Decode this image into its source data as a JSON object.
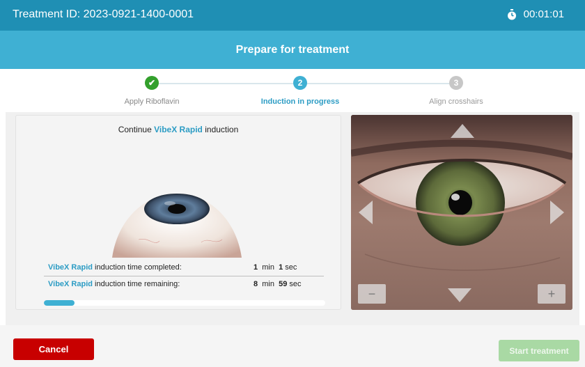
{
  "topbar": {
    "treatment_id": "Treatment ID: 2023-0921-1400-0001",
    "timer": "00:01:01",
    "timer_icon": "stopwatch-icon"
  },
  "header": {
    "title": "Prepare for treatment"
  },
  "steps": [
    {
      "number": "✔",
      "label": "Apply Riboflavin",
      "state": "done"
    },
    {
      "number": "2",
      "label": "Induction in progress",
      "state": "active"
    },
    {
      "number": "3",
      "label": "Align crosshairs",
      "state": "pending"
    }
  ],
  "induction": {
    "instruction_prefix": "Continue ",
    "product": "VibeX Rapid",
    "instruction_suffix": " induction",
    "completed_label": " induction time completed:",
    "completed_min": "1",
    "completed_sec": "1",
    "remaining_label": " induction time remaining:",
    "remaining_min": "8",
    "remaining_sec": "59",
    "min_unit": "min",
    "sec_unit": "sec",
    "progress_fraction": 0.11
  },
  "camera": {
    "controls": [
      "arrow-up-icon",
      "arrow-down-icon",
      "arrow-left-icon",
      "arrow-right-icon",
      "zoom-out-icon",
      "zoom-in-icon"
    ],
    "minus": "−",
    "plus": "+"
  },
  "footer": {
    "cancel": "Cancel",
    "start": "Start treatment"
  },
  "colors": {
    "topbar": "#1f8fb4",
    "header": "#3fb0d3",
    "accent": "#2c9cc4",
    "done": "#33a02c",
    "cancel": "#c80000",
    "start_disabled": "#a9d9a4"
  }
}
